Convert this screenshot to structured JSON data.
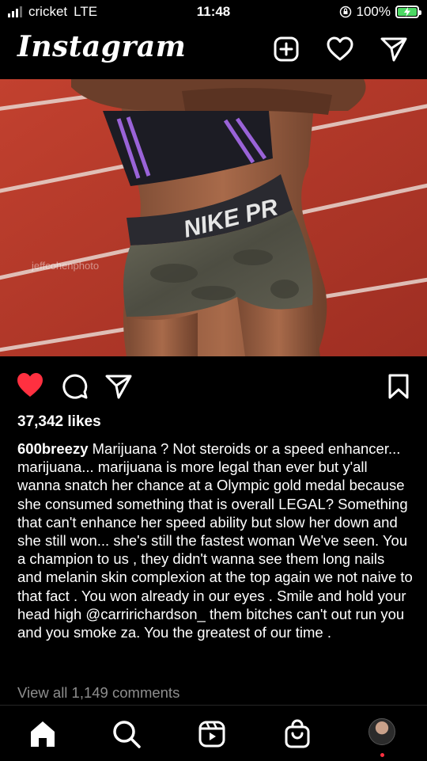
{
  "status_bar": {
    "carrier": "cricket",
    "network": "LTE",
    "time": "11:48",
    "battery": "100%",
    "battery_charging": true
  },
  "header": {
    "logo": "Instagram",
    "icons": [
      "new-post-icon",
      "heart-icon",
      "direct-message-icon"
    ]
  },
  "post": {
    "image_watermark": "jeffcohenphoto",
    "liked": true,
    "like_color": "#ff3040",
    "likes": "37,342 likes",
    "username": "600breezy",
    "caption": "Marijuana ? Not steroids or a speed enhancer... marijuana... marijuana is more legal than ever but y'all wanna snatch her chance at a Olympic gold medal because she consumed something that is overall LEGAL?  Something that can't enhance her speed ability but slow her down and she still won... she's still the fastest woman We've seen. You a champion to us , they didn't wanna see them long nails and melanin skin complexion at the top again we not naive to that fact . You won already in our eyes . Smile and hold your head high @carririchardson_ them bitches can't out run you and you smoke za. You the greatest of our time .",
    "view_comments": "View all 1,149 comments"
  },
  "bottom_nav": {
    "items": [
      "home-icon",
      "search-icon",
      "reels-icon",
      "shop-icon",
      "profile-avatar"
    ]
  }
}
